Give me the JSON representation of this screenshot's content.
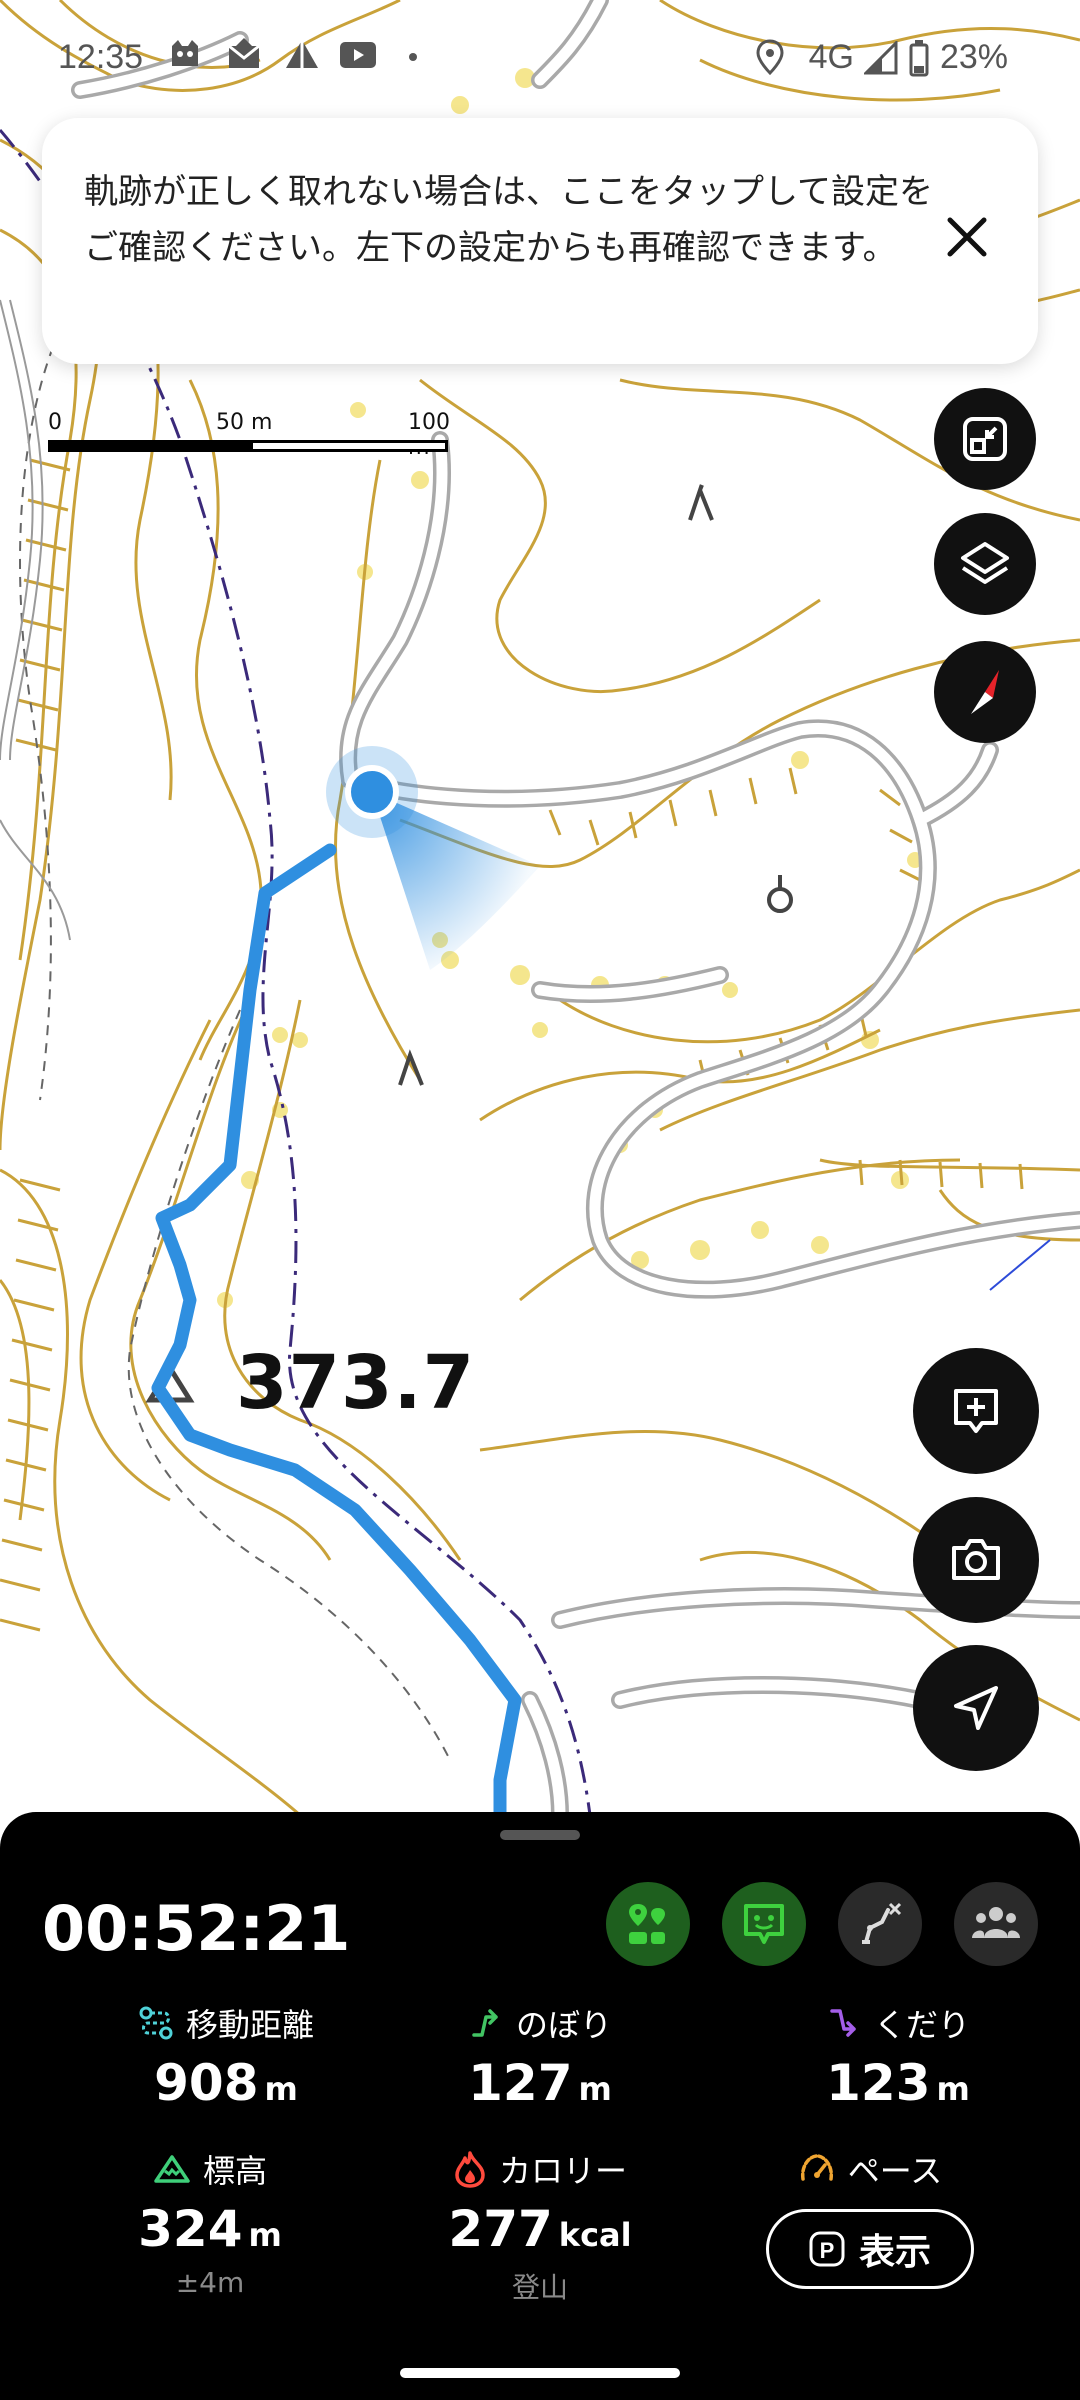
{
  "status_bar": {
    "time": "12:35",
    "network": "4G",
    "battery": "23%",
    "notification_icons": [
      "app-icon",
      "mail-icon",
      "triangle-icon",
      "video-icon",
      "dot-icon"
    ],
    "system_icons": [
      "location-icon",
      "signal-icon",
      "battery-icon"
    ]
  },
  "banner": {
    "message": "軌跡が正しく取れない場合は、ここをタップして設定をご確認ください。左下の設定からも再確認できます。",
    "close_icon": "close-icon"
  },
  "scale": {
    "labels": [
      "0",
      "50 m",
      "100 m"
    ]
  },
  "map": {
    "summit_label": "373.7",
    "colors": {
      "contour": "#c9a23a",
      "road": "#a9a9a9",
      "track": "#2f8fe0",
      "boundary": "#3b2a7a",
      "highlight": "#f3e27a"
    }
  },
  "map_buttons": [
    "fit-screen-icon",
    "layers-icon",
    "compass-icon",
    "add-note-icon",
    "camera-icon",
    "navigation-icon"
  ],
  "panel": {
    "timer": "00:52:21",
    "toolbar_icons": [
      "route-marker-icon",
      "chat-icon",
      "route-edit-icon",
      "group-icon"
    ],
    "stats": [
      {
        "icon": "distance-icon",
        "label": "移動距離",
        "value": "908",
        "unit": "m",
        "sub": ""
      },
      {
        "icon": "ascent-icon",
        "label": "のぼり",
        "value": "127",
        "unit": "m",
        "sub": ""
      },
      {
        "icon": "descent-icon",
        "label": "くだり",
        "value": "123",
        "unit": "m",
        "sub": ""
      },
      {
        "icon": "mountain-icon",
        "label": "標高",
        "value": "324",
        "unit": "m",
        "sub": "±4m"
      },
      {
        "icon": "flame-icon",
        "label": "カロリー",
        "value": "277",
        "unit": "kcal",
        "sub": "登山"
      },
      {
        "icon": "speedometer-icon",
        "label": "ペース",
        "value": "",
        "unit": "",
        "sub": ""
      }
    ],
    "show_button": {
      "badge": "P",
      "label": "表示"
    },
    "colors": {
      "accent_green": "#3ed13e",
      "distance": "#4fd2d8",
      "ascent": "#42c463",
      "descent": "#a45ee8",
      "mountain": "#3fcf7a",
      "flame": "#ff4a3d",
      "pace": "#f0a531"
    }
  }
}
